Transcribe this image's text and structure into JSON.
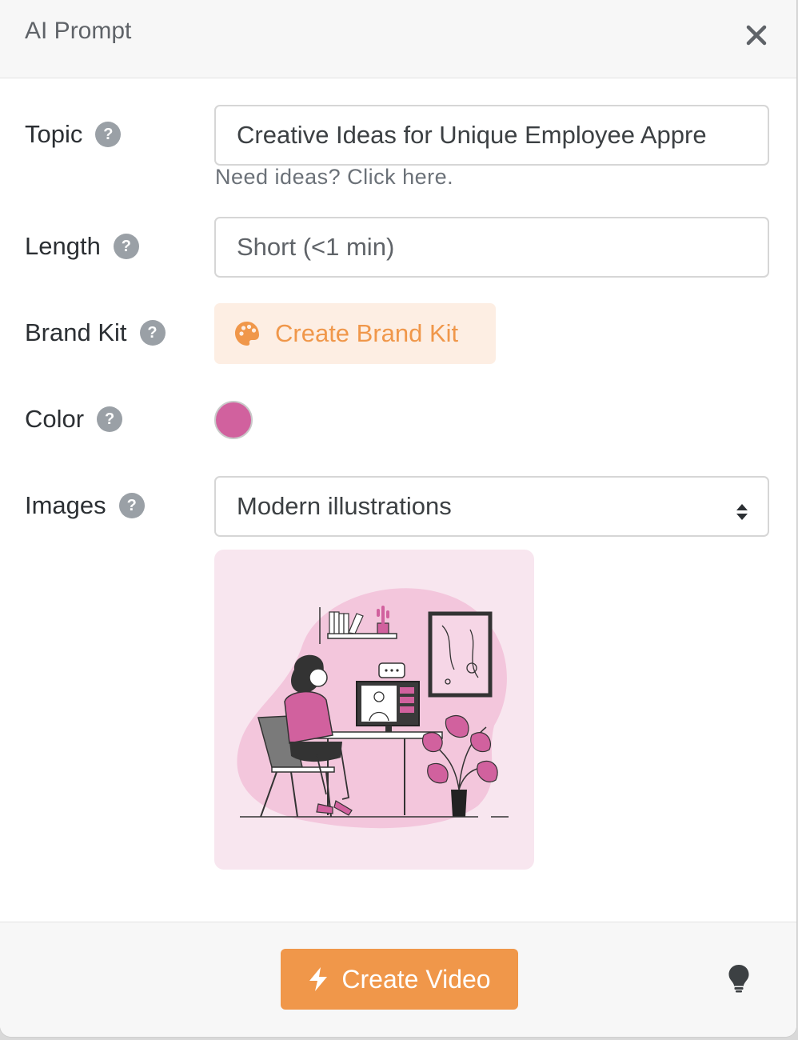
{
  "modal": {
    "title": "AI Prompt",
    "close_icon": "close-icon"
  },
  "form": {
    "topic": {
      "label": "Topic",
      "value": "Creative Ideas for Unique Employee Appre",
      "hint": "Need ideas? Click here."
    },
    "length": {
      "label": "Length",
      "value": "Short (<1 min)"
    },
    "brand_kit": {
      "label": "Brand Kit",
      "button_label": "Create Brand Kit",
      "icon": "palette-icon"
    },
    "color": {
      "label": "Color",
      "value": "#d1619e"
    },
    "images": {
      "label": "Images",
      "selected": "Modern illustrations",
      "preview": "illustration-preview"
    },
    "help_glyph": "?"
  },
  "footer": {
    "create_video_label": "Create Video",
    "bolt_icon": "bolt-icon",
    "tip_icon": "lightbulb-icon"
  },
  "colors": {
    "accent": "#f0974a",
    "accent_soft": "#fdeee3",
    "pink": "#d1619e"
  }
}
